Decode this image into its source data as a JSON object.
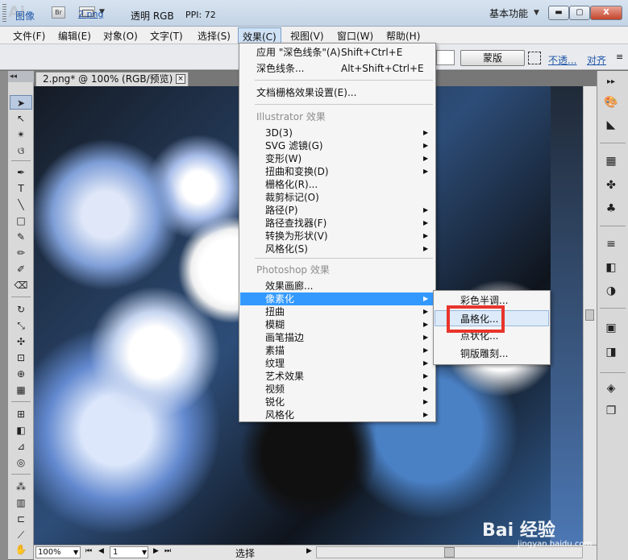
{
  "titlebar": {
    "logo": "Ai",
    "bridge": "Br",
    "workspace": "基本功能",
    "close": "X"
  },
  "menus": {
    "file": "文件(F)",
    "edit": "编辑(E)",
    "object": "对象(O)",
    "type": "文字(T)",
    "select": "选择(S)",
    "effect": "效果(C)",
    "view": "视图(V)",
    "window": "窗口(W)",
    "help": "帮助(H)"
  },
  "control_bar": {
    "image": "图像",
    "file": "2.png",
    "mode": "透明 RGB",
    "ppi": "PPI: 72",
    "mask": "蒙版",
    "opacity": "不透...",
    "align": "对齐"
  },
  "document": {
    "tab_title": "2.png* @ 100% (RGB/预览)"
  },
  "status": {
    "zoom": "100%",
    "page": "1",
    "tool": "选择"
  },
  "effect_menu": {
    "apply_last": "应用 \"深色线条\"(A)",
    "apply_last_shortcut": "Shift+Ctrl+E",
    "last_effect": "深色线条...",
    "last_effect_shortcut": "Alt+Shift+Ctrl+E",
    "raster_settings": "文档栅格效果设置(E)...",
    "illustrator_header": "Illustrator 效果",
    "illustrator_items": [
      "3D(3)",
      "SVG 滤镜(G)",
      "变形(W)",
      "扭曲和变换(D)",
      "栅格化(R)...",
      "裁剪标记(O)",
      "路径(P)",
      "路径查找器(F)",
      "转换为形状(V)",
      "风格化(S)"
    ],
    "photoshop_header": "Photoshop 效果",
    "photoshop_items": [
      "效果画廊...",
      "像素化",
      "扭曲",
      "模糊",
      "画笔描边",
      "素描",
      "纹理",
      "艺术效果",
      "视频",
      "锐化",
      "风格化"
    ]
  },
  "pixelate_menu": {
    "items": [
      "彩色半调...",
      "晶格化...",
      "点状化...",
      "铜版雕刻..."
    ]
  },
  "watermark": {
    "text": "Bai 经验",
    "url": "jingyan.baidu.com"
  }
}
